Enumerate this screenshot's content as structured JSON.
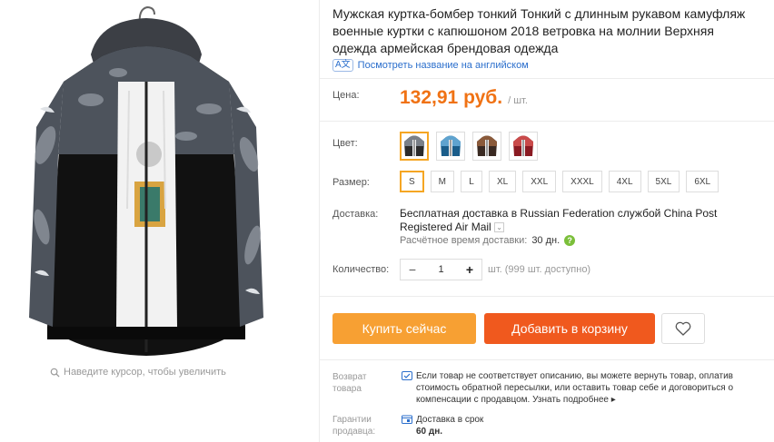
{
  "gallery": {
    "zoom_hint": "Наведите курсор, чтобы увеличить"
  },
  "product": {
    "title": "Мужская куртка-бомбер тонкий Тонкий с длинным рукавом камуфляж военные куртки с капюшоном 2018 ветровка на молнии Верхняя одежда армейская брендовая одежда",
    "translate_label": "Посмотреть название на английском"
  },
  "price": {
    "label": "Цена:",
    "value": "132,91 руб.",
    "unit": "/ шт."
  },
  "color": {
    "label": "Цвет:",
    "options": [
      {
        "name": "black-camo",
        "primary": "#2b2b2b",
        "accent": "#7a8088",
        "selected": true
      },
      {
        "name": "blue-camo",
        "primary": "#1a5d8a",
        "accent": "#5fa3cf",
        "selected": false
      },
      {
        "name": "brown-camo",
        "primary": "#3a2a22",
        "accent": "#8a5a3a",
        "selected": false
      },
      {
        "name": "red-camo",
        "primary": "#8a1a22",
        "accent": "#c94a4a",
        "selected": false
      }
    ]
  },
  "size": {
    "label": "Размер:",
    "options": [
      "S",
      "M",
      "L",
      "XL",
      "XXL",
      "XXXL",
      "4XL",
      "5XL",
      "6XL"
    ],
    "selected": "S"
  },
  "delivery": {
    "label": "Доставка:",
    "text": "Бесплатная доставка в Russian Federation службой China Post Registered Air Mail",
    "eta_label": "Расчётное время доставки:",
    "eta_value": "30 дн."
  },
  "quantity": {
    "label": "Количество:",
    "minus": "−",
    "value": "1",
    "plus": "+",
    "available": "шт. (999 шт. доступно)"
  },
  "actions": {
    "buy_now": "Купить сейчас",
    "add_to_cart": "Добавить в корзину"
  },
  "services": {
    "return_label_1": "Возврат",
    "return_label_2": "товара",
    "return_text": "Если товар не соответствует описанию, вы можете вернуть товар, оплатив стоимость обратной пересылки, или оставить товар себе и договориться о компенсации с продавцом.",
    "return_link": "Узнать подробнее",
    "guarantee_label_1": "Гарантии",
    "guarantee_label_2": "продавца:",
    "guarantee_text": "Доставка в срок",
    "guarantee_value": "60 дн."
  },
  "colors": {
    "price": "#f07214",
    "buy_now": "#f7a033",
    "add_to_cart": "#f0591e",
    "link": "#2a6ecc",
    "selected_border": "#f5a623"
  }
}
